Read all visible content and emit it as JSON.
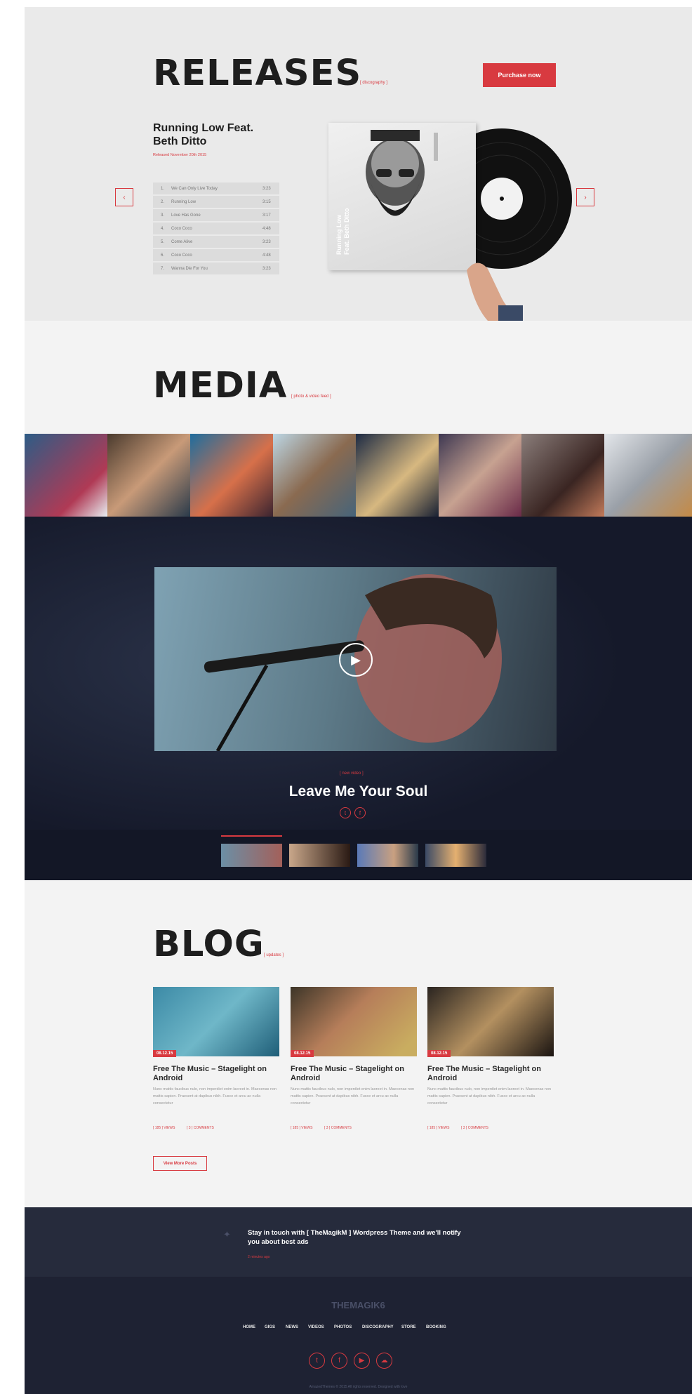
{
  "releases": {
    "heading": "RELEASES",
    "tag": "[ discography ]",
    "purchase_label": "Purchase now",
    "album_title_1": "Running Low Feat.",
    "album_title_2": "Beth Ditto",
    "released": "Released November 20th 2015",
    "cover_text_1": "Running Low",
    "cover_text_2": "Feat. Beth Ditto",
    "prev_icon": "chevron-left-icon",
    "next_icon": "chevron-right-icon",
    "tracks": [
      {
        "num": "1.",
        "title": "We Can Only Live Today",
        "duration": "3:23"
      },
      {
        "num": "2.",
        "title": "Running Low",
        "duration": "3:15"
      },
      {
        "num": "3.",
        "title": "Love Has Gone",
        "duration": "3:17"
      },
      {
        "num": "4.",
        "title": "Coco Coco",
        "duration": "4:48"
      },
      {
        "num": "5.",
        "title": "Come Alive",
        "duration": "3:23"
      },
      {
        "num": "6.",
        "title": "Coco Coco",
        "duration": "4:48"
      },
      {
        "num": "7.",
        "title": "Wanna Die For You",
        "duration": "3:23"
      }
    ]
  },
  "media": {
    "heading": "MEDIA",
    "tag": "[ photo & video feed ]",
    "video_tag": "[ new video ]",
    "video_title": "Leave Me Your Soul",
    "play_icon": "play-icon"
  },
  "blog": {
    "heading": "BLOG",
    "tag": "[ updates ]",
    "more_label": "View More Posts",
    "posts": [
      {
        "date": "08.12.15",
        "title": "Free The Music – Stagelight on Android",
        "body": "Nunc mattis faucibus nulo, non imperdiet enim laoreet in. Maecenas non mattis sapien. Praesent at dapibus nibh. Fusce et arcu ac nulla consectetur",
        "views": "[ 185 ] VIEWS",
        "comments": "[ 3 ] COMMENTS"
      },
      {
        "date": "08.12.15",
        "title": "Free The Music – Stagelight on Android",
        "body": "Nunc mattis faucibus nulo, non imperdiet enim laoreet in. Maecenas non mattis sapien. Praesent at dapibus nibh. Fusce et arcu ac nulla consectetur",
        "views": "[ 185 ] VIEWS",
        "comments": "[ 3 ] COMMENTS"
      },
      {
        "date": "08.12.15",
        "title": "Free The Music – Stagelight on Android",
        "body": "Nunc mattis faucibus nulo, non imperdiet enim laoreet in. Maecenas non mattis sapien. Praesent at dapibus nibh. Fusce et arcu ac nulla consectetur",
        "views": "[ 185 ] VIEWS",
        "comments": "[ 3 ] COMMENTS"
      }
    ]
  },
  "newsletter": {
    "text_1": "Stay in touch with [ TheMagikM ] Wordpress Theme and we'll notify",
    "text_2": "you about best ads",
    "sub": "2 minutes ago",
    "twitter_icon": "twitter-icon"
  },
  "footer": {
    "logo": "THEMAGIK6",
    "nav": [
      "HOME",
      "GIGS",
      "NEWS",
      "VIDEOS",
      "PHOTOS",
      "DISCOGRAPHY",
      "STORE",
      "BOOKING"
    ],
    "social_icons": [
      "twitter-icon",
      "facebook-icon",
      "youtube-icon",
      "soundcloud-icon"
    ],
    "copyright": "AmazedThemes © 2015 All rights reserved. Designed with love"
  },
  "colors": {
    "accent": "#d83a40",
    "dark": "#15192a",
    "footer": "#1e2233"
  }
}
